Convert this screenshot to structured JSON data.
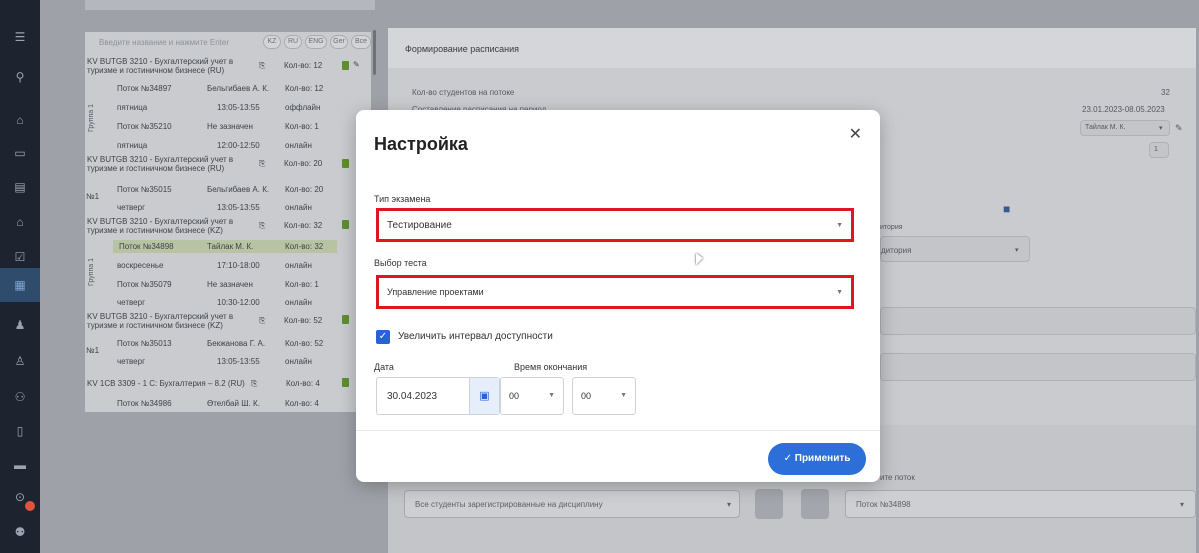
{
  "left_list": {
    "search_placeholder": "Введите название и нажмите Enter",
    "lang_filters": [
      "KZ",
      "RU",
      "ENG",
      "Ger",
      "Все"
    ],
    "courses": [
      {
        "title1": "KV BUTGB 3210 - Бухгалтерский учет в",
        "title2": "туризме и гостиничном бизнесе (RU)",
        "count": "Кол-во: 12"
      },
      {
        "title1": "KV BUTGB 3210 - Бухгалтерский учет в",
        "title2": "туризме и гостиничном бизнесе (RU)",
        "count": "Кол-во: 20"
      },
      {
        "title1": "KV BUTGB 3210 - Бухгалтерский учет в",
        "title2": "туризме и гостиничном бизнесе (KZ)",
        "count": "Кол-во: 32"
      },
      {
        "title1": "KV BUTGB 3210 - Бухгалтерский учет в",
        "title2": "туризме и гостиничном бизнесе (KZ)",
        "count": "Кол-во: 52"
      },
      {
        "title1": "KV 1СВ 3309 - 1 С: Бухгалтерия – 8.2 (RU)",
        "title2": "",
        "count": "Кол-во: 4"
      }
    ],
    "rows": [
      {
        "a": "Поток №34897",
        "b": "Бельгибаев А. К.",
        "c": "Кол-во: 12"
      },
      {
        "a": "пятница",
        "b": "13:05-13:55",
        "c": "оффлайн"
      },
      {
        "a": "Поток №35210",
        "b": "Не зазначен",
        "c": "Кол-во: 1"
      },
      {
        "a": "пятница",
        "b": "12:00-12:50",
        "c": "онлайн"
      },
      {
        "a": "Поток №35015",
        "b": "Бельгибаев А. К.",
        "c": "Кол-во: 20"
      },
      {
        "a": "четверг",
        "b": "13:05-13:55",
        "c": "онлайн"
      },
      {
        "a": "Поток №34898",
        "b": "Тайлак М. К.",
        "c": "Кол-во: 32"
      },
      {
        "a": "воскресенье",
        "b": "17:10-18:00",
        "c": "онлайн"
      },
      {
        "a": "Поток №35079",
        "b": "Не зазначен",
        "c": "Кол-во: 1"
      },
      {
        "a": "четверг",
        "b": "10:30-12:00",
        "c": "онлайн"
      },
      {
        "a": "Поток №35013",
        "b": "Бекжанова Г. А.",
        "c": "Кол-во: 52"
      },
      {
        "a": "четверг",
        "b": "13:05-13:55",
        "c": "онлайн"
      },
      {
        "a": "Поток №34986",
        "b": "Өтелбай Ш. К.",
        "c": "Кол-во: 4"
      }
    ],
    "group_label": "Группа 1",
    "n1_label": "№1"
  },
  "right": {
    "title": "Формирование расписания",
    "students_label": "Кол-во студентов на потоке",
    "students_value": "32",
    "period_label": "Составление расписания на период",
    "period_value": "23.01.2023-08.05.2023",
    "teacher": "Тайлак М. К.",
    "one": "1",
    "auditoria_small": "итория",
    "auditoria_placeholder": "дитория",
    "bottom_select": "Все студенты зарегистрированные на дисциплину",
    "choose_stream_label": "ите поток",
    "stream_value": "Поток №34898"
  },
  "modal": {
    "title": "Настройка",
    "exam_type_label": "Тип экзамена",
    "exam_type_value": "Тестирование",
    "test_label": "Выбор теста",
    "test_value": "Управление проектами",
    "checkbox_label": "Увеличить интервал доступности",
    "date_label": "Дата",
    "date_value": "30.04.2023",
    "end_time_label": "Время окончания",
    "hours_value": "00",
    "minutes_value": "00",
    "apply_label": "Применить"
  },
  "colors": {
    "accent": "#2d6fd8",
    "highlight_border": "#e0161e",
    "rail": "#1d2430"
  }
}
